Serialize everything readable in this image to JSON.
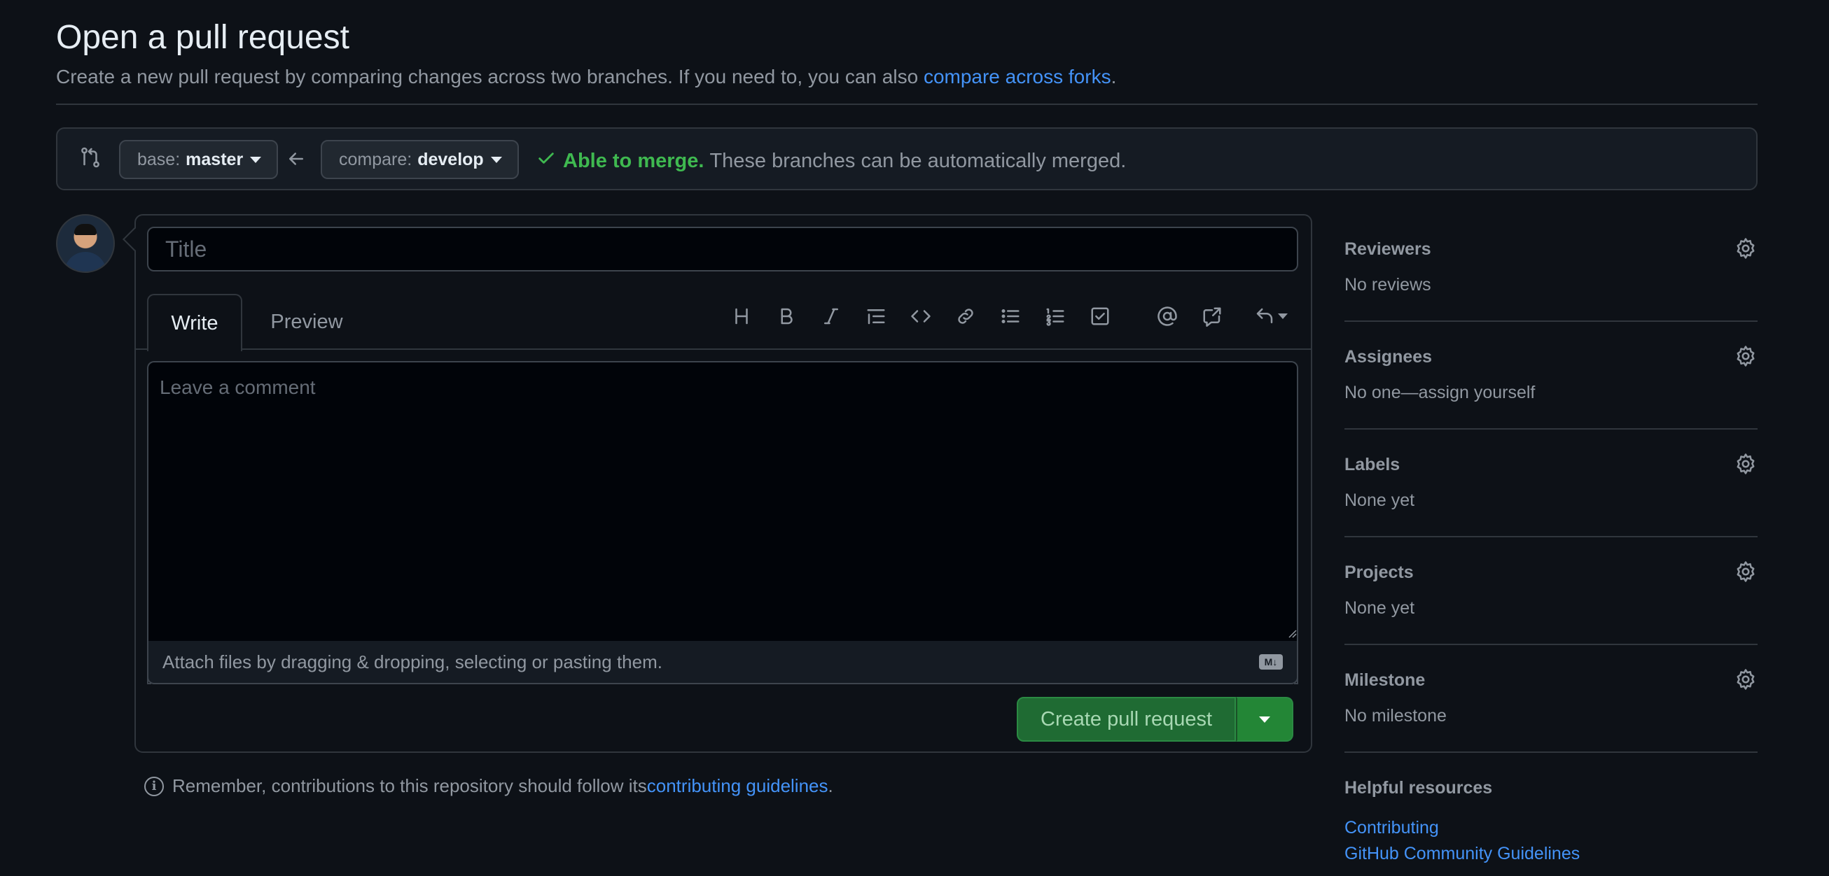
{
  "header": {
    "title": "Open a pull request",
    "subtitle_pre": "Create a new pull request by comparing changes across two branches. If you need to, you can also ",
    "subtitle_link": "compare across forks",
    "subtitle_post": "."
  },
  "range": {
    "base_prefix": "base:",
    "base_branch": "master",
    "compare_prefix": "compare:",
    "compare_branch": "develop",
    "merge_ok": "Able to merge.",
    "merge_msg": "These branches can be automatically merged."
  },
  "composer": {
    "title_placeholder": "Title",
    "tabs": {
      "write": "Write",
      "preview": "Preview"
    },
    "comment_placeholder": "Leave a comment",
    "attach_text": "Attach files by dragging & dropping, selecting or pasting them.",
    "markdown_badge": "M↓",
    "create_label": "Create pull request"
  },
  "note": {
    "pre": "Remember, contributions to this repository should follow its ",
    "link": "contributing guidelines",
    "post": "."
  },
  "sidebar": {
    "reviewers": {
      "label": "Reviewers",
      "value": "No reviews"
    },
    "assignees": {
      "label": "Assignees",
      "value": "No one—assign yourself"
    },
    "labels": {
      "label": "Labels",
      "value": "None yet"
    },
    "projects": {
      "label": "Projects",
      "value": "None yet"
    },
    "milestone": {
      "label": "Milestone",
      "value": "No milestone"
    },
    "helpful": {
      "label": "Helpful resources",
      "links": [
        "Contributing",
        "GitHub Community Guidelines"
      ]
    }
  },
  "colors": {
    "background": "#0d1117",
    "accent_link": "#4493f8",
    "success": "#3fb950",
    "primary_button": "#238636"
  }
}
